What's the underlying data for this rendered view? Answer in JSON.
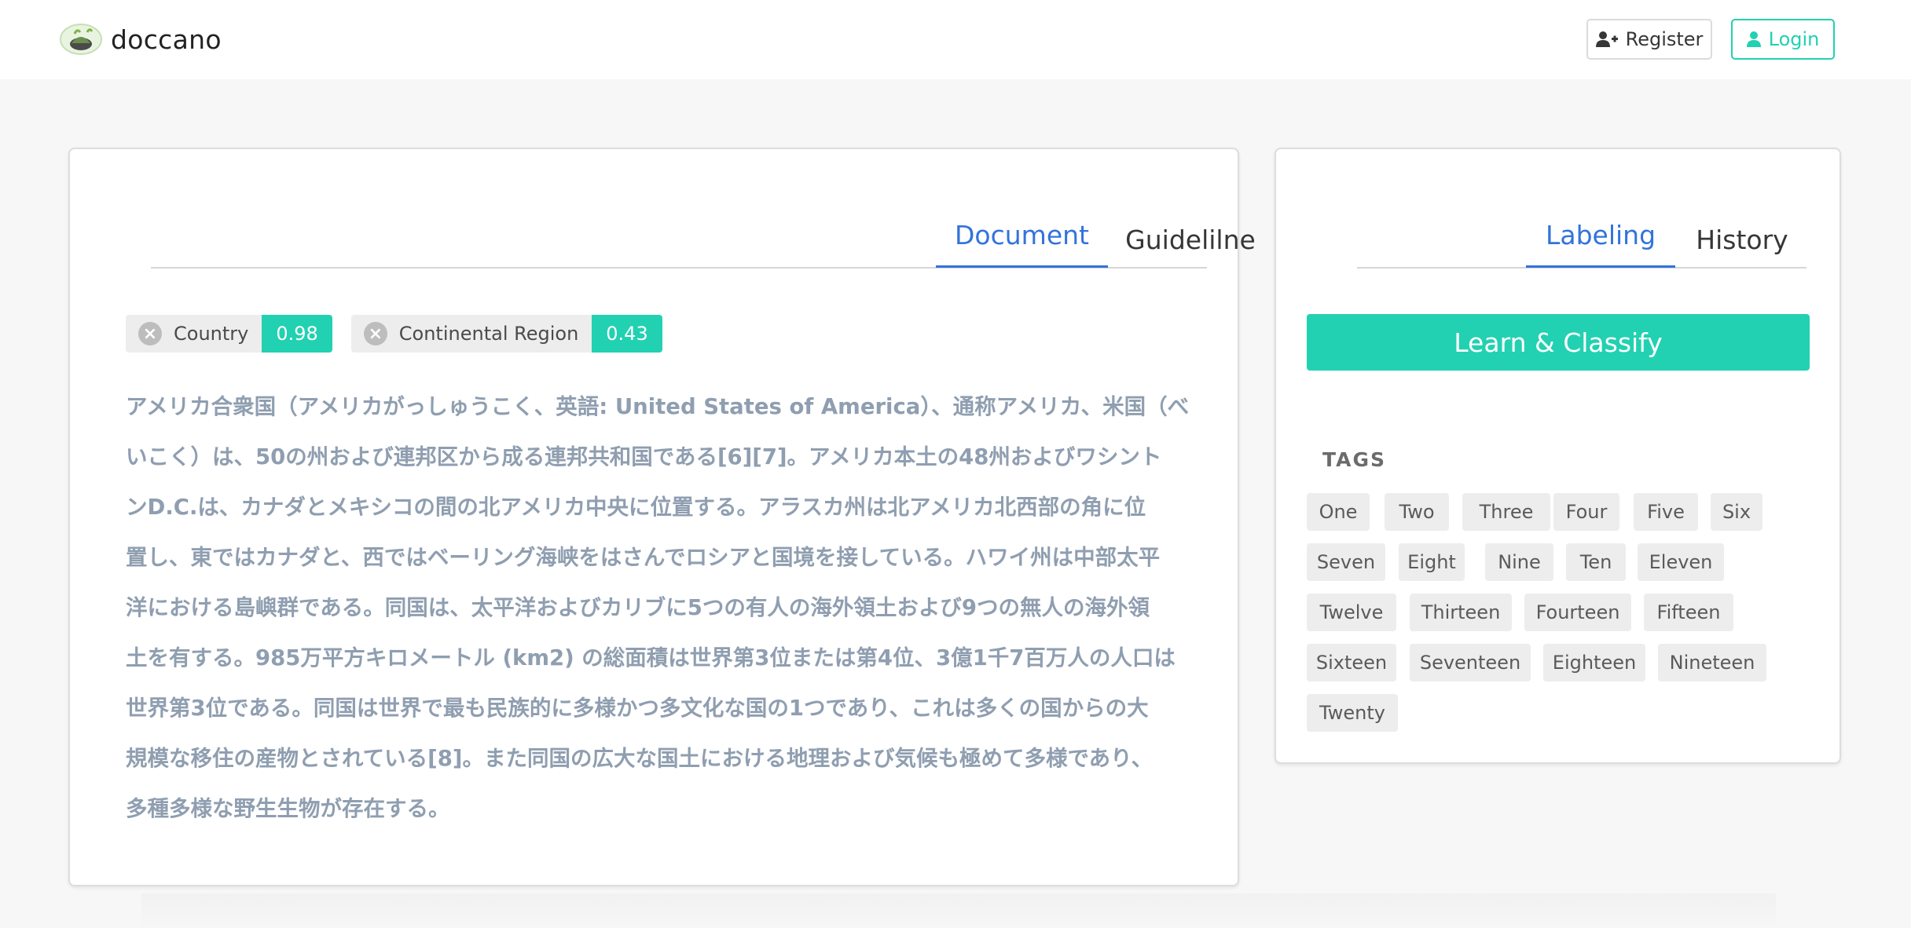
{
  "app": {
    "name": "doccano",
    "logo_icon": "doccano-logo-icon"
  },
  "nav": {
    "register_label": "Register",
    "register_icon": "user-plus-icon",
    "login_label": "Login",
    "login_icon": "user-icon"
  },
  "document_panel": {
    "tabs": [
      {
        "label": "Document",
        "active": true
      },
      {
        "label": "Guidelilne",
        "active": false
      }
    ],
    "entities": [
      {
        "label": "Country",
        "score": "0.98"
      },
      {
        "label": "Continental Region",
        "score": "0.43"
      }
    ],
    "text_lines": [
      "アメリカ合衆国（アメリカがっしゅうこく、英語: United States of America）、通称アメリカ、米国（べ",
      "いこく）は、50の州および連邦区から成る連邦共和国である[6][7]。アメリカ本土の48州およびワシント",
      "ンD.C.は、カナダとメキシコの間の北アメリカ中央に位置する。アラスカ州は北アメリカ北西部の角に位",
      "置し、東ではカナダと、西ではベーリング海峡をはさんでロシアと国境を接している。ハワイ州は中部太平",
      "洋における島嶼群である。同国は、太平洋およびカリブに5つの有人の海外領土および9つの無人の海外領",
      "土を有する。985万平方キロメートル (km2) の総面積は世界第3位または第4位、3億1千7百万人の人口は",
      "世界第3位である。同国は世界で最も民族的に多様かつ多文化な国の1つであり、これは多くの国からの大",
      "規模な移住の産物とされている[8]。また同国の広大な国土における地理および気候も極めて多様であり、",
      "多種多様な野生生物が存在する。"
    ]
  },
  "side_panel": {
    "tabs": [
      {
        "label": "Labeling",
        "active": true
      },
      {
        "label": "History",
        "active": false
      }
    ],
    "learn_button": "Learn & Classify",
    "tags_heading": "TAGS",
    "tags": [
      "One",
      "Two",
      "Three",
      "Four",
      "Five",
      "Six",
      "Seven",
      "Eight",
      "Nine",
      "Ten",
      "Eleven",
      "Twelve",
      "Thirteen",
      "Fourteen",
      "Fifteen",
      "Sixteen",
      "Seventeen",
      "Eighteen",
      "Nineteen",
      "Twenty"
    ]
  },
  "colors": {
    "accent": "#22d1b1",
    "tab_active": "#3273dc",
    "doc_text": "#8f9eb0"
  }
}
